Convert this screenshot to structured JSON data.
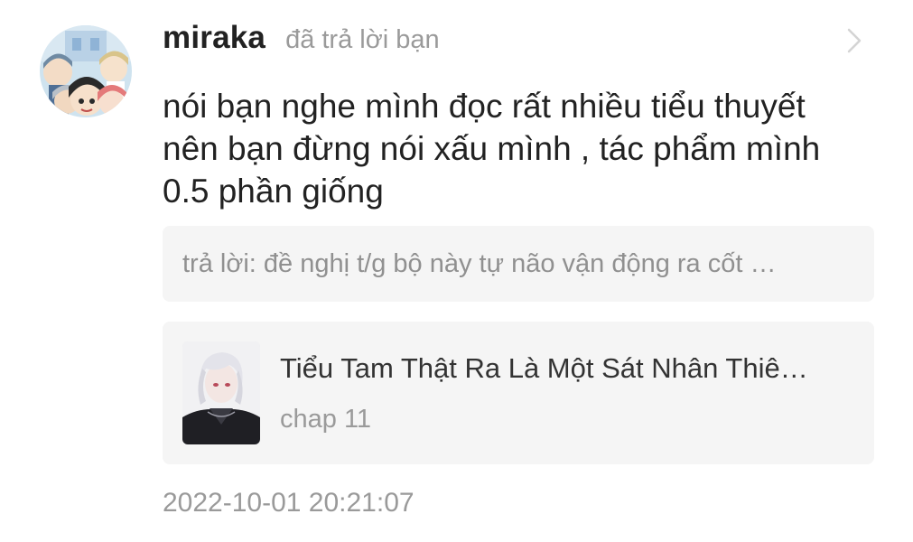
{
  "reply": {
    "username": "miraka",
    "action_text": "đã trả lời bạn",
    "message": "nói bạn nghe mình đọc rất nhiều tiểu thuyết\nnên bạn đừng nói xấu mình , tác phẩm mình\n0.5 phần giống",
    "quoted_reply": "trả lời: đề nghị t/g bộ này tự não vận động ra cốt …",
    "timestamp": "2022-10-01 20:21:07"
  },
  "book": {
    "title": "Tiểu Tam Thật Ra Là Một Sát Nhân Thiê…",
    "chapter": "chap 11"
  },
  "icons": {
    "avatar": "anime-group-avatar",
    "chevron": "chevron-right-icon",
    "cover": "anime-character-cover"
  },
  "colors": {
    "text_primary": "#222222",
    "text_secondary": "#9a9a9a",
    "card_background": "#f5f5f5"
  }
}
